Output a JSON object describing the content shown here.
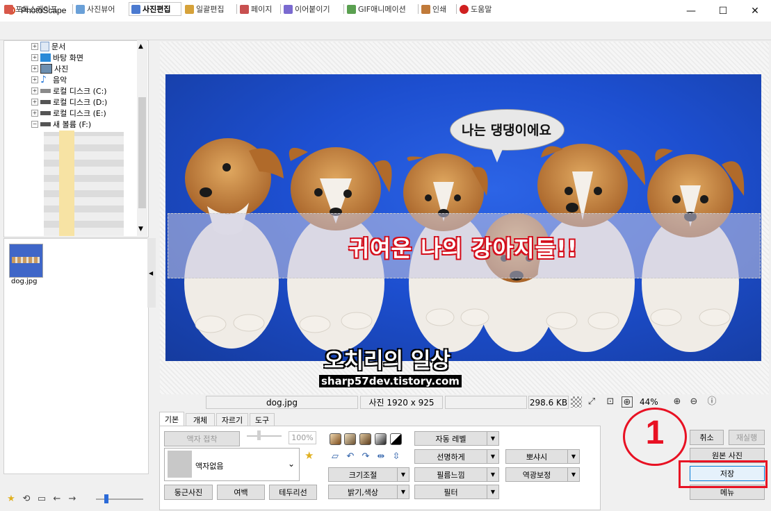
{
  "window": {
    "title": "PhotoScape",
    "minimize": "—",
    "maximize": "☐",
    "close": "✕"
  },
  "tabs": [
    {
      "label": "포토스케이프",
      "color": "#d8584a"
    },
    {
      "label": "사진뷰어",
      "color": "#6aa0d8"
    },
    {
      "label": "사진편집",
      "color": "#4b7ad0",
      "active": true
    },
    {
      "label": "일괄편집",
      "color": "#d6a23a"
    },
    {
      "label": "페이지",
      "color": "#c85050"
    },
    {
      "label": "이어붙이기",
      "color": "#7a6ad0"
    },
    {
      "label": "GIF애니메이션",
      "color": "#5aa050"
    },
    {
      "label": "인쇄",
      "color": "#c07a3a"
    },
    {
      "label": "도움말",
      "color": "#d02020"
    }
  ],
  "tree": {
    "items": [
      {
        "label": "문서",
        "icon": "document-folder-icon"
      },
      {
        "label": "바탕 화면",
        "icon": "desktop-icon"
      },
      {
        "label": "사진",
        "icon": "pictures-folder-icon"
      },
      {
        "label": "음악",
        "icon": "music-folder-icon"
      },
      {
        "label": "로컬 디스크 (C:)",
        "icon": "drive-icon"
      },
      {
        "label": "로컬 디스크 (D:)",
        "icon": "drive-icon"
      },
      {
        "label": "로컬 디스크 (E:)",
        "icon": "drive-icon"
      },
      {
        "label": "새 볼륨 (F:)",
        "icon": "drive-icon"
      }
    ]
  },
  "files": [
    {
      "name": "dog.jpg"
    }
  ],
  "image": {
    "bubble_text": "나는 댕댕이에요",
    "banner_text": "귀여운 나의 강아지들!!",
    "watermark_title": "오치리의 일상",
    "watermark_url": "sharp57dev.tistory.com"
  },
  "infobar": {
    "filename": "dog.jpg",
    "dimensions": "사진 1920 x 925",
    "filesize": "298.6 KB",
    "zoom": "44%"
  },
  "panel_tabs": [
    "기본",
    "개체",
    "자르기",
    "도구"
  ],
  "panel": {
    "frame_fit": "액자 접착",
    "frame_percent": "100%",
    "frame_select": "액자없음",
    "round_photo": "둥근사진",
    "margin": "여백",
    "border_line": "테두리선",
    "resize": "크기조절",
    "brightness": "밝기,색상",
    "auto_level": "자동 레벨",
    "sharpen": "선명하게",
    "film": "필름느낌",
    "filter": "필터",
    "bloom": "뽀샤시",
    "backlight": "역광보정"
  },
  "actions": {
    "undo": "취소",
    "redo": "재실행",
    "original": "원본 사진",
    "save": "저장",
    "menu": "메뉴"
  },
  "annotation": {
    "number": "1",
    "color": "#e81123"
  }
}
